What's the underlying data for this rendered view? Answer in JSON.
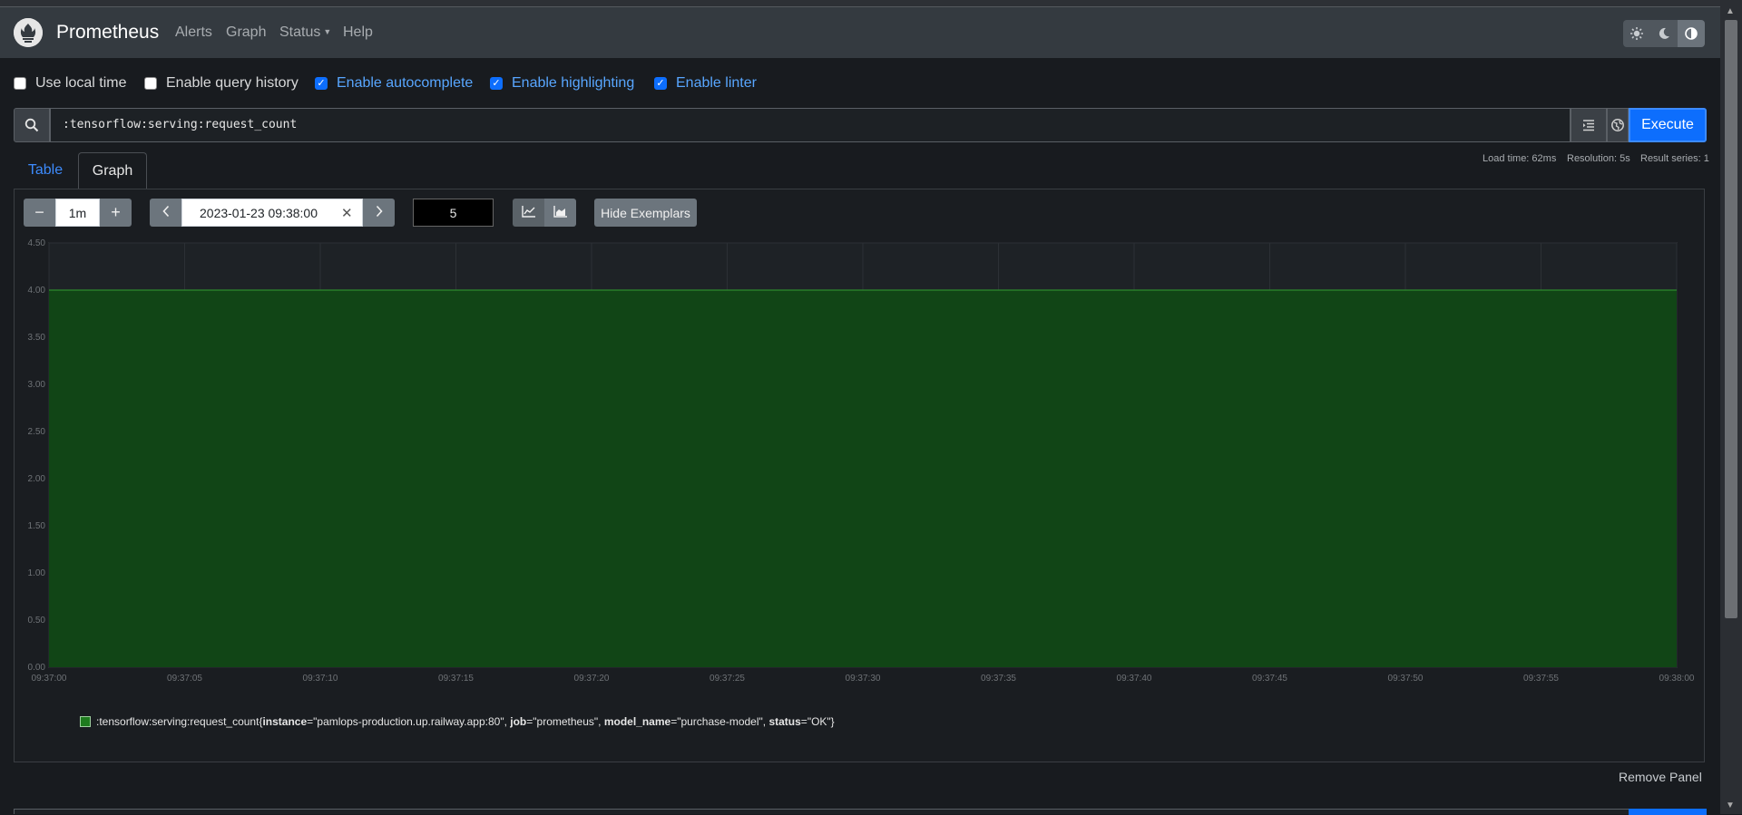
{
  "navbar": {
    "brand": "Prometheus",
    "items": [
      {
        "label": "Alerts"
      },
      {
        "label": "Graph"
      },
      {
        "label": "Status"
      },
      {
        "label": "Help"
      }
    ],
    "theme_icons": [
      "sun-icon",
      "moon-icon",
      "contrast-icon"
    ]
  },
  "options": [
    {
      "label": "Use local time",
      "checked": false
    },
    {
      "label": "Enable query history",
      "checked": false
    },
    {
      "label": "Enable autocomplete",
      "checked": true
    },
    {
      "label": "Enable highlighting",
      "checked": true
    },
    {
      "label": "Enable linter",
      "checked": true
    }
  ],
  "query": {
    "expression": ":tensorflow:serving:request_count",
    "execute_label": "Execute"
  },
  "tabs": [
    {
      "label": "Table",
      "active": false
    },
    {
      "label": "Graph",
      "active": true
    }
  ],
  "stats": {
    "load_time": "Load time: 62ms",
    "resolution": "Resolution: 5s",
    "result_series": "Result series: 1"
  },
  "graph_controls": {
    "range": "1m",
    "end_time": "2023-01-23 09:38:00",
    "resolution_value": "5",
    "hide_exemplars": "Hide Exemplars"
  },
  "colors": {
    "series_fill": "#114516",
    "series_line": "#2d8a2d",
    "accent": "#0d6efd"
  },
  "chart_data": {
    "type": "area",
    "x": [
      "09:37:00",
      "09:37:05",
      "09:37:10",
      "09:37:15",
      "09:37:20",
      "09:37:25",
      "09:37:30",
      "09:37:35",
      "09:37:40",
      "09:37:45",
      "09:37:50",
      "09:37:55",
      "09:38:00"
    ],
    "y_ticks": [
      "0.00",
      "0.50",
      "1.00",
      "1.50",
      "2.00",
      "2.50",
      "3.00",
      "3.50",
      "4.00",
      "4.50"
    ],
    "ylim": [
      0,
      4.5
    ],
    "grid": true,
    "series": [
      {
        "values": [
          4,
          4,
          4,
          4,
          4,
          4,
          4,
          4,
          4,
          4,
          4,
          4,
          4
        ]
      }
    ],
    "legend": {
      "metric": ":tensorflow:serving:request_count",
      "open": "{",
      "labels": [
        {
          "key": "instance",
          "value": "\"pamlops-production.up.railway.app:80\"",
          "sep": ", "
        },
        {
          "key": "job",
          "value": "\"prometheus\"",
          "sep": ", "
        },
        {
          "key": "model_name",
          "value": "\"purchase-model\"",
          "sep": ", "
        },
        {
          "key": "status",
          "value": "\"OK\"",
          "sep": ""
        }
      ],
      "close": "}"
    }
  },
  "footer": {
    "remove_panel": "Remove Panel"
  }
}
